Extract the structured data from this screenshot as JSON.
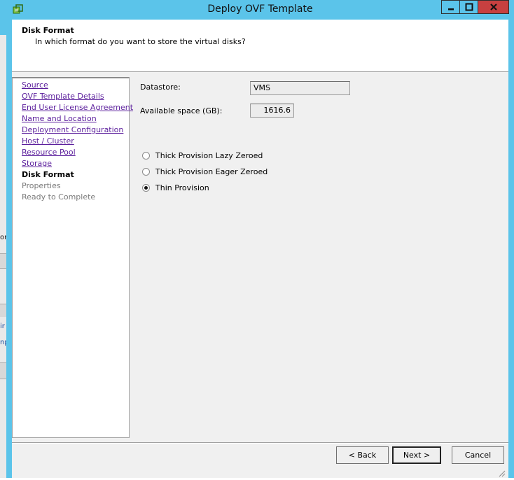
{
  "window": {
    "title": "Deploy OVF Template",
    "icon": "vsphere-app-icon",
    "controls": [
      "minimize-icon",
      "maximize-icon",
      "close-icon"
    ]
  },
  "header": {
    "title": "Disk Format",
    "subtitle": "In which format do you want to store the virtual disks?"
  },
  "nav": {
    "items": [
      {
        "label": "Source",
        "state": "link"
      },
      {
        "label": "OVF Template Details",
        "state": "link"
      },
      {
        "label": "End User License Agreement",
        "state": "link"
      },
      {
        "label": "Name and Location",
        "state": "link"
      },
      {
        "label": "Deployment Configuration",
        "state": "link"
      },
      {
        "label": "Host / Cluster",
        "state": "link"
      },
      {
        "label": "Resource Pool",
        "state": "link"
      },
      {
        "label": "Storage",
        "state": "link"
      },
      {
        "label": "Disk Format",
        "state": "current"
      },
      {
        "label": "Properties",
        "state": "disabled"
      },
      {
        "label": "Ready to Complete",
        "state": "disabled"
      }
    ]
  },
  "form": {
    "datastore_label": "Datastore:",
    "datastore_value": "VMS",
    "space_label": "Available space (GB):",
    "space_value": "1616.6",
    "options": [
      {
        "label": "Thick Provision Lazy Zeroed",
        "selected": false
      },
      {
        "label": "Thick Provision Eager Zeroed",
        "selected": false
      },
      {
        "label": "Thin Provision",
        "selected": true
      }
    ]
  },
  "buttons": {
    "back": "< Back",
    "next": "Next >",
    "cancel": "Cancel"
  },
  "background_window": {
    "texts": [
      "on",
      "ir",
      "np"
    ]
  },
  "colors": {
    "titlebar": "#5bc4ea",
    "link": "#5b1e9c",
    "close_button": "#c74040"
  }
}
